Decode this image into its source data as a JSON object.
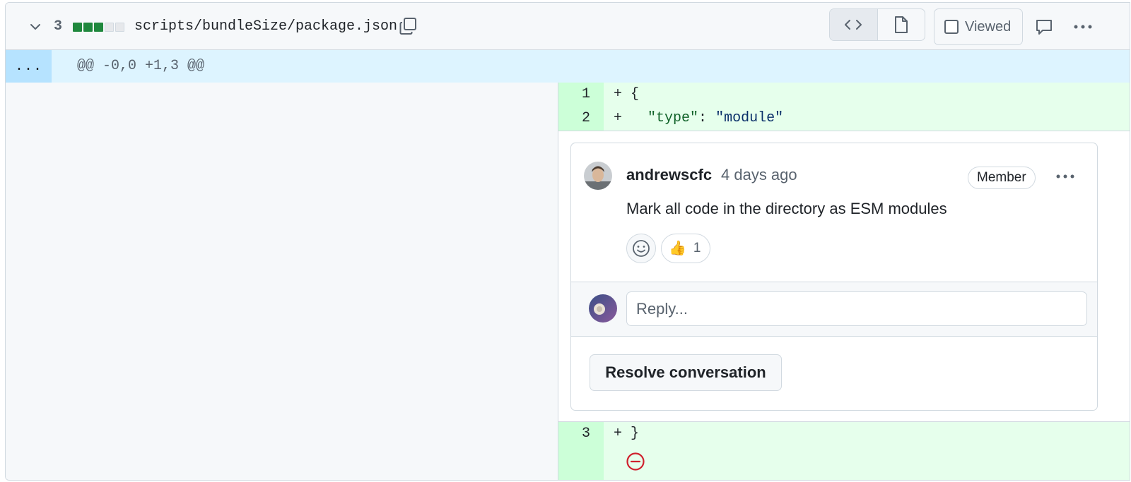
{
  "file_header": {
    "change_count": "3",
    "diffstat": [
      "add",
      "add",
      "add",
      "neutral",
      "neutral"
    ],
    "path": "scripts/bundleSize/package.json",
    "viewed_label": "Viewed",
    "viewed_checked": false
  },
  "hunk": {
    "expand_label": "...",
    "header": "@@ -0,0 +1,3 @@"
  },
  "lines": [
    {
      "number": "1",
      "prefix": "+",
      "content": " {"
    },
    {
      "number": "2",
      "prefix": "+",
      "content_pre": "   ",
      "key": "\"type\"",
      "sep": ": ",
      "value": "\"module\""
    },
    {
      "number": "3",
      "prefix": "+",
      "content": " }"
    }
  ],
  "comment": {
    "author": "andrewscfc",
    "time": "4 days ago",
    "badge": "Member",
    "body": "Mark all code in the directory as ESM modules",
    "reactions": [
      {
        "emoji": "👍",
        "count": "1"
      }
    ],
    "reply_placeholder": "Reply...",
    "resolve_label": "Resolve conversation"
  },
  "colors": {
    "addition_bg": "#e6ffec",
    "addition_num_bg": "#ccffd8",
    "hunk_bg": "#ddf4ff",
    "diffstat_add": "#1f883d",
    "blocked_icon": "#cf222e"
  }
}
